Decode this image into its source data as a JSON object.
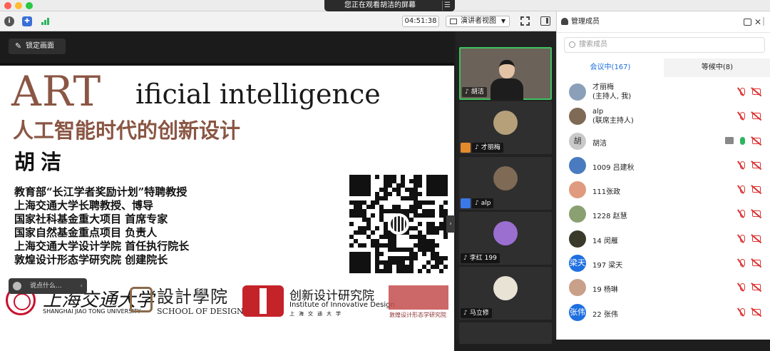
{
  "banner": {
    "text": "您正在观看胡洁的屏幕"
  },
  "toolbar": {
    "timer": "04:51:38",
    "view_label": "演讲者视图"
  },
  "stage": {
    "lock_label": "锁定画面",
    "chat_placeholder": "说点什么..."
  },
  "slide": {
    "title_art": "ART",
    "title_rest": "ificial intelligence",
    "subtitle": "人工智能时代的创新设计",
    "author": "胡洁",
    "titles": [
      "教育部“长江学者奖励计划”特聘教授",
      "上海交通大学长聘教授、博导",
      "国家社科基金重大项目 首席专家",
      "国家自然基金重点项目 负责人",
      "上海交通大学设计学院 首任执行院长",
      "敦煌设计形态学研究院 创建院长"
    ],
    "logos": {
      "sjtu_cn": "上海交通大学",
      "sjtu_en": "SHANGHAI JIAO TONG UNIVERSITY",
      "sod_cn": "設計學院",
      "sod_en": "SCHOOL OF DESIGN",
      "iid_cn": "创新设计研究院",
      "iid_en": "Institute of Innovative Design",
      "iid_sub": "上海交通大学",
      "dh_cn": "敦煌设计形态学研究院"
    }
  },
  "videos": [
    {
      "name": "胡洁",
      "avatar_color": "#6b625a"
    },
    {
      "name": "才丽梅",
      "avatar_color": "#b6a07a"
    },
    {
      "name": "alp",
      "avatar_color": "#7f6a55"
    },
    {
      "name": "李红 199",
      "avatar_color": "#9b6fd0"
    },
    {
      "name": "马立修",
      "avatar_color": "#e9e3d6"
    }
  ],
  "panel": {
    "title": "管理成员",
    "search_placeholder": "搜索成员",
    "tab_meeting": "会议中(167)",
    "tab_waiting": "等候中(8)",
    "members": [
      {
        "line1": "才丽梅",
        "line2": "(主持人, 我)",
        "avatar": "",
        "color": "#8aa0b8",
        "mic": "off"
      },
      {
        "line1": "alp",
        "line2": "(联席主持人)",
        "avatar": "",
        "color": "#7f6a55",
        "mic": "off"
      },
      {
        "line1": "胡洁",
        "line2": "",
        "avatar": "胡",
        "color": "#c9c9c9",
        "mic": "on"
      },
      {
        "line1": "1009 吕建秋",
        "line2": "",
        "avatar": "",
        "color": "#4a7bc0",
        "mic": "off"
      },
      {
        "line1": "111张政",
        "line2": "",
        "avatar": "",
        "color": "#e09a80",
        "mic": "off"
      },
      {
        "line1": "1228 赵慧",
        "line2": "",
        "avatar": "",
        "color": "#8aa070",
        "mic": "off"
      },
      {
        "line1": "14 闵雁",
        "line2": "",
        "avatar": "",
        "color": "#3a3a2a",
        "mic": "off"
      },
      {
        "line1": "197 梁天",
        "line2": "",
        "avatar": "梁天",
        "color": "#1e6fe0",
        "mic": "off"
      },
      {
        "line1": "19 杨琳",
        "line2": "",
        "avatar": "",
        "color": "#c9a08a",
        "mic": "off"
      },
      {
        "line1": "22 张伟",
        "line2": "",
        "avatar": "张伟",
        "color": "#1e6fe0",
        "mic": "off"
      }
    ]
  }
}
